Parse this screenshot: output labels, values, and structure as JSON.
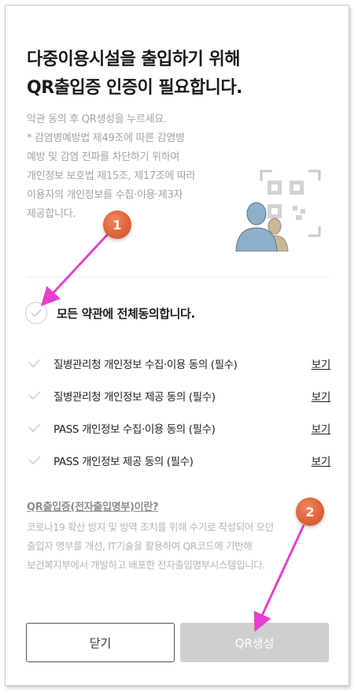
{
  "header": {
    "title_line1": "다중이용시설을 출입하기 위해",
    "title_line2": "QR출입증 인증이 필요합니다."
  },
  "description": {
    "lines": [
      "약관 동의 후 QR생성을 누르세요.",
      "* 감염병예방법 제49조에 따른 감염병",
      "예방 및 감염 전파를 차단하기 위하여",
      "개인정보 보호법 제15조, 제17조에 따라",
      "이용자의 개인정보를 수집·이용·제3자",
      "제공합니다."
    ]
  },
  "agreement": {
    "all_label": "모든 약관에 전체동의합니다.",
    "terms": [
      {
        "label": "질병관리청 개인정보 수집·이용 동의 (필수)",
        "view": "보기"
      },
      {
        "label": "질병관리청 개인정보 제공 동의 (필수)",
        "view": "보기"
      },
      {
        "label": "PASS 개인정보 수집·이용 동의 (필수)",
        "view": "보기"
      },
      {
        "label": "PASS 개인정보 제공 동의 (필수)",
        "view": "보기"
      }
    ]
  },
  "info": {
    "title": "QR출입증(전자출입명부)이란?",
    "lines": [
      "코로나19 확산 방지 및 방역 조치를 위해 수기로 작성되어 오던",
      "출입자 명부를 개선, IT기술을 활용하여 QR코드에 기반해",
      "보건복지부에서 개발하고 배포한 전자출입명부시스템입니다."
    ]
  },
  "buttons": {
    "close_label": "닫기",
    "qr_label": "QR생성"
  },
  "annotations": {
    "marker1": "1",
    "marker2": "2",
    "arrow_color": "#e83fd0",
    "marker_color": "#e0633a"
  },
  "colors": {
    "qr_disabled_bg": "#cfcfcf",
    "muted_text": "#a3a3a3",
    "person_blue": "#8eafc8",
    "person_tan": "#c8b893"
  }
}
